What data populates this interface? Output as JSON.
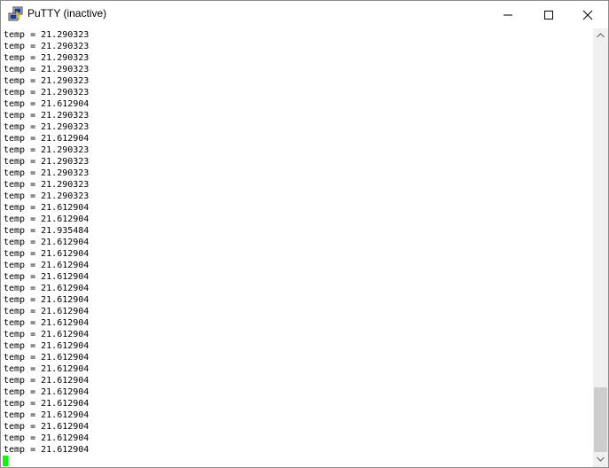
{
  "window": {
    "title": "PuTTY (inactive)",
    "icons": {
      "app": "putty-icon",
      "minimize": "minimize-icon",
      "maximize": "maximize-icon",
      "close": "close-icon",
      "scroll_up": "chevron-up-icon",
      "scroll_down": "chevron-down-icon"
    }
  },
  "terminal": {
    "lines": [
      "temp = 21.290323",
      "temp = 21.290323",
      "temp = 21.290323",
      "temp = 21.290323",
      "temp = 21.290323",
      "temp = 21.290323",
      "temp = 21.612904",
      "temp = 21.290323",
      "temp = 21.290323",
      "temp = 21.612904",
      "temp = 21.290323",
      "temp = 21.290323",
      "temp = 21.290323",
      "temp = 21.290323",
      "temp = 21.290323",
      "temp = 21.612904",
      "temp = 21.612904",
      "temp = 21.935484",
      "temp = 21.612904",
      "temp = 21.612904",
      "temp = 21.612904",
      "temp = 21.612904",
      "temp = 21.612904",
      "temp = 21.612904",
      "temp = 21.612904",
      "temp = 21.612904",
      "temp = 21.612904",
      "temp = 21.612904",
      "temp = 21.612904",
      "temp = 21.612904",
      "temp = 21.612904",
      "temp = 21.612904",
      "temp = 21.612904",
      "temp = 21.612904",
      "temp = 21.612904",
      "temp = 21.612904",
      "temp = 21.612904"
    ],
    "cursor_color": "#00ff00",
    "text_color": "#000000",
    "background_color": "#ffffff"
  },
  "scrollbar": {
    "scroll_position": "bottom"
  }
}
